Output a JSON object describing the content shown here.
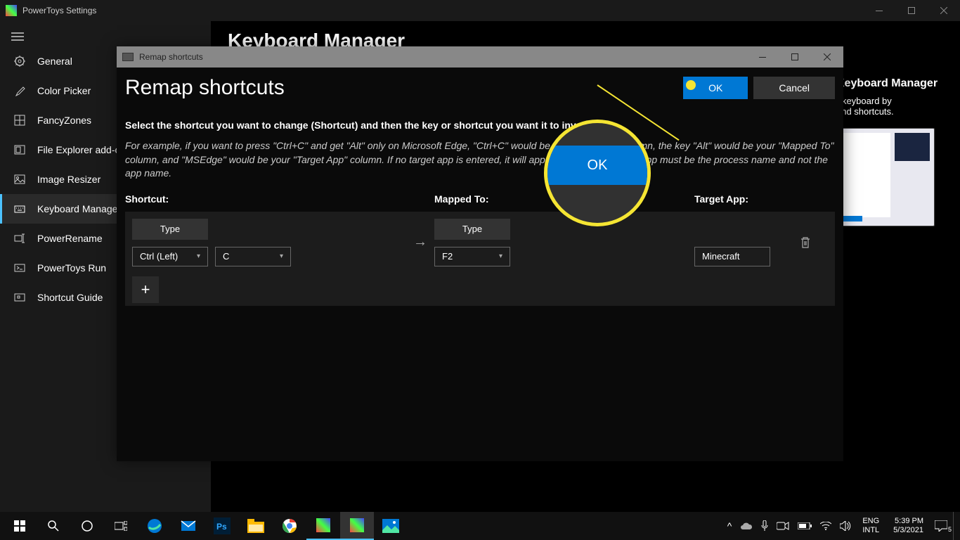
{
  "titlebar": {
    "title": "PowerToys Settings"
  },
  "page": {
    "title": "Keyboard Manager"
  },
  "sidebar": {
    "items": [
      {
        "label": "General",
        "icon": "gear"
      },
      {
        "label": "Color Picker",
        "icon": "eyedropper"
      },
      {
        "label": "FancyZones",
        "icon": "grid"
      },
      {
        "label": "File Explorer add-ons",
        "icon": "preview"
      },
      {
        "label": "Image Resizer",
        "icon": "image"
      },
      {
        "label": "Keyboard Manager",
        "icon": "keyboard"
      },
      {
        "label": "PowerRename",
        "icon": "rename"
      },
      {
        "label": "PowerToys Run",
        "icon": "run"
      },
      {
        "label": "Shortcut Guide",
        "icon": "guide"
      }
    ]
  },
  "rightPanel": {
    "heading": "Keyboard Manager",
    "desc1": "r keyboard by",
    "desc2": "and shortcuts."
  },
  "dialog": {
    "windowTitle": "Remap shortcuts",
    "title": "Remap shortcuts",
    "ok": "OK",
    "cancel": "Cancel",
    "instructions": "Select the shortcut you want to change (Shortcut) and then the key or shortcut you want it to invoke.",
    "example": "For example, if you want to press \"Ctrl+C\" and get \"Alt\" only on Microsoft Edge, \"Ctrl+C\" would be your \"Shortcut\" column, the key \"Alt\" would be your \"Mapped To\" column, and \"MSEdge\" would be your \"Target App\" column. If no target app is entered, it will apply globally. The target app must be the process name and not the app name.",
    "cols": {
      "shortcut": "Shortcut:",
      "mapped": "Mapped To:",
      "target": "Target App:"
    },
    "typeLabel": "Type",
    "row": {
      "key1": "Ctrl (Left)",
      "key2": "C",
      "mapped": "F2",
      "target": "Minecraft"
    }
  },
  "highlight": {
    "label": "OK"
  },
  "taskbar": {
    "lang1": "ENG",
    "lang2": "INTL",
    "time": "5:39 PM",
    "date": "5/3/2021",
    "notif": "5"
  }
}
